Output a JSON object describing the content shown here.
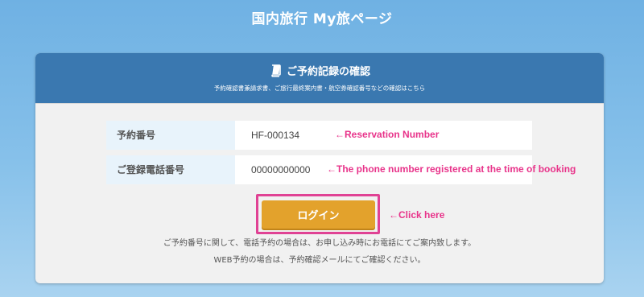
{
  "page": {
    "title": "国内旅行 My旅ページ"
  },
  "card": {
    "title": "ご予約記録の確認",
    "subtitle": "予約確認書兼請求書、ご旅行最終案内書・航空券確認番号などの確認はこちら",
    "icon": "book-icon"
  },
  "form": {
    "reservation": {
      "label": "予約番号",
      "value": "HF-000134",
      "annotation": "←Reservation Number"
    },
    "phone": {
      "label": "ご登録電話番号",
      "value": "00000000000",
      "annotation": "←The phone number registered at the time of booking"
    }
  },
  "login": {
    "label": "ログイン",
    "annotation": "←Click here"
  },
  "notes": {
    "line1": "ご予約番号に関して、電話予約の場合は、お申し込み時にお電話にてご案内致します。",
    "line2": "WEB予約の場合は、予約確認メールにてご確認ください。"
  },
  "colors": {
    "header_blue": "#3a78b0",
    "button_orange": "#e3a22c",
    "annotation_pink": "#e8338a"
  }
}
